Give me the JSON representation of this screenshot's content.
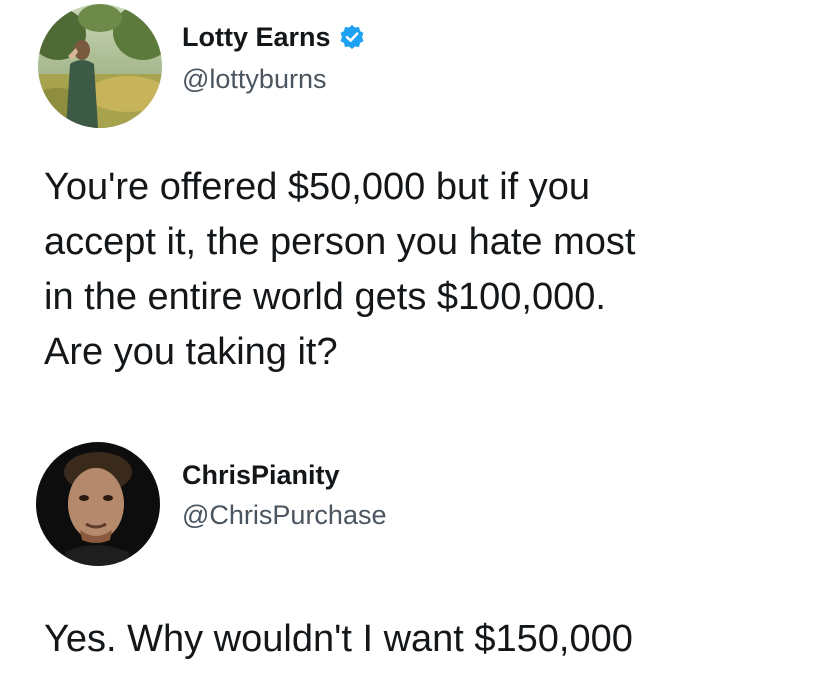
{
  "tweets": [
    {
      "display_name": "Lotty Earns",
      "verified": true,
      "handle": "@lottyburns",
      "text_lines": [
        "You're offered $50,000 but if you",
        "accept it, the person you hate most",
        "in the entire world gets $100,000.",
        "Are you taking it?"
      ]
    },
    {
      "display_name": "ChrisPianity",
      "verified": false,
      "handle": "@ChrisPurchase",
      "text_lines": [
        "Yes. Why wouldn't I want $150,000"
      ]
    }
  ],
  "colors": {
    "verified_badge": "#1da1f2",
    "handle": "#4a5560",
    "text": "#14171a"
  }
}
